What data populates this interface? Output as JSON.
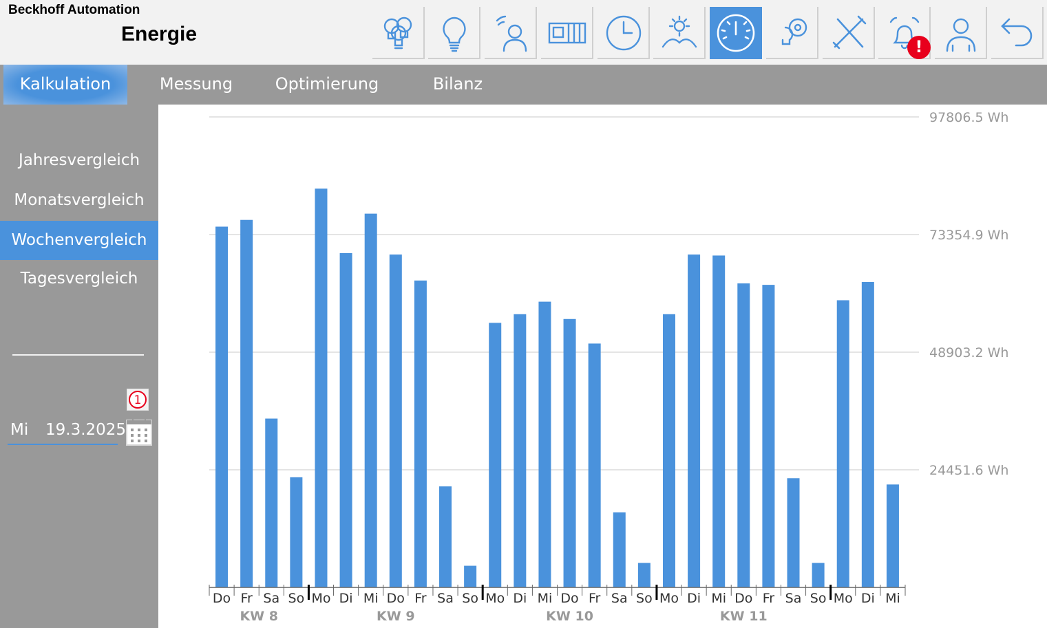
{
  "header": {
    "company": "Beckhoff Automation",
    "title": "Energie",
    "icons": [
      {
        "name": "lighting-groups-icon",
        "active": false
      },
      {
        "name": "lightbulb-icon",
        "active": false
      },
      {
        "name": "presence-sensor-icon",
        "active": false
      },
      {
        "name": "blinds-icon",
        "active": false
      },
      {
        "name": "clock-icon",
        "active": false
      },
      {
        "name": "weather-icon",
        "active": false
      },
      {
        "name": "energy-gauge-icon",
        "active": true
      },
      {
        "name": "settings-icon",
        "active": false
      },
      {
        "name": "tools-icon",
        "active": false
      },
      {
        "name": "alarm-bell-icon",
        "active": false
      },
      {
        "name": "user-icon",
        "active": false
      },
      {
        "name": "back-icon",
        "active": false
      }
    ],
    "alarm_badge": "!"
  },
  "tabs": [
    {
      "label": "Kalkulation",
      "active": true
    },
    {
      "label": "Messung",
      "active": false
    },
    {
      "label": "Optimierung",
      "active": false
    },
    {
      "label": "Bilanz",
      "active": false
    }
  ],
  "sidebar": {
    "items": [
      {
        "label": "Jahresvergleich",
        "active": false
      },
      {
        "label": "Monatsvergleich",
        "active": false
      },
      {
        "label": "Wochenvergleich",
        "active": true
      },
      {
        "label": "Tagesvergleich",
        "active": false
      }
    ],
    "weekday": "Mi",
    "date": "19.3.2025",
    "pending_badge": "1"
  },
  "colors": {
    "accent": "#4a92dc",
    "panel": "#999999",
    "header_bg": "#f2f2f2",
    "alarm": "#e8001c"
  },
  "chart_data": {
    "type": "bar",
    "unit": "Wh",
    "yticks": [
      "97806.5 Wh",
      "73354.9 Wh",
      "48903.2 Wh",
      "24451.6 Wh"
    ],
    "ytick_values": [
      97806.5,
      73354.9,
      48903.2,
      24451.6
    ],
    "ylim": [
      0,
      97806.5
    ],
    "grid": true,
    "categories": [
      "Do",
      "Fr",
      "Sa",
      "So",
      "Mo",
      "Di",
      "Mi",
      "Do",
      "Fr",
      "Sa",
      "So",
      "Mo",
      "Di",
      "Mi",
      "Do",
      "Fr",
      "Sa",
      "So",
      "Mo",
      "Di",
      "Mi",
      "Do",
      "Fr",
      "Sa",
      "So",
      "Mo",
      "Di",
      "Mi"
    ],
    "values": [
      75000,
      76400,
      35100,
      22900,
      82900,
      69500,
      77700,
      69200,
      63800,
      21000,
      4500,
      55000,
      56800,
      59400,
      55800,
      50700,
      15600,
      5100,
      56800,
      69200,
      69000,
      63200,
      62900,
      22700,
      5100,
      59700,
      63500,
      21400
    ],
    "weeks": [
      {
        "label": "KW 8",
        "start": 0,
        "end": 3
      },
      {
        "label": "KW 9",
        "start": 4,
        "end": 10
      },
      {
        "label": "KW 10",
        "start": 11,
        "end": 17
      },
      {
        "label": "KW 11",
        "start": 18,
        "end": 24
      }
    ],
    "week_separators": [
      4,
      11,
      18,
      25
    ],
    "bar_color": "#4a92dc"
  }
}
